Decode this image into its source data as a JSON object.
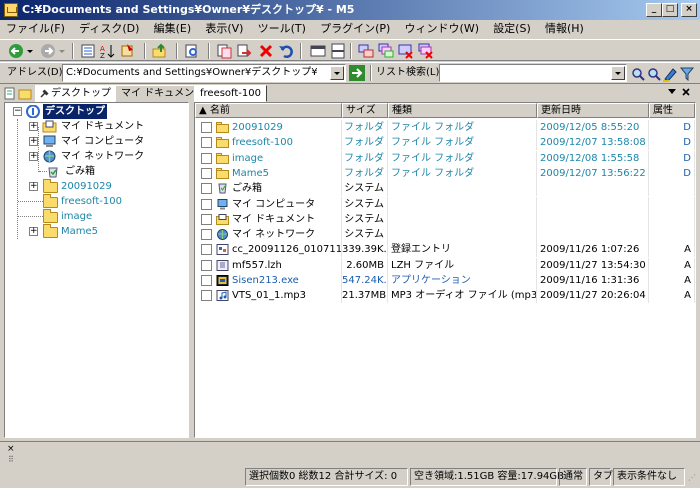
{
  "window": {
    "title": "C:¥Documents and Settings¥Owner¥デスクトップ¥ - M5",
    "min": "_",
    "max": "□",
    "close": "×"
  },
  "menu": [
    "ファイル(F)",
    "ディスク(D)",
    "編集(E)",
    "表示(V)",
    "ツール(T)",
    "プラグイン(P)",
    "ウィンドウ(W)",
    "設定(S)",
    "情報(H)"
  ],
  "address": {
    "label": "アドレス(D)",
    "value": "C:¥Documents and Settings¥Owner¥デスクトップ¥",
    "search_label": "リスト検索(L)",
    "search_value": ""
  },
  "tree_tabs": {
    "desktop": "デスクトップ",
    "mydocs": "マイ ドキュメント"
  },
  "list_tab": "freesoft-100",
  "tree": {
    "root": "デスクトップ",
    "items": [
      "マイ ドキュメント",
      "マイ コンピュータ",
      "マイ ネットワーク",
      "ごみ箱",
      "20091029",
      "freesoft-100",
      "image",
      "Mame5"
    ]
  },
  "columns": {
    "name": "▲ 名前",
    "size": "サイズ",
    "type": "種類",
    "date": "更新日時",
    "attr": "属性"
  },
  "rows": [
    {
      "name": "20091029",
      "size": "フォルダ",
      "type": "ファイル フォルダ",
      "date": "2009/12/05 8:55:20",
      "attr": "D",
      "icon": "folder-icon",
      "color": "teal"
    },
    {
      "name": "freesoft-100",
      "size": "フォルダ",
      "type": "ファイル フォルダ",
      "date": "2009/12/07 13:58:08",
      "attr": "D",
      "icon": "folder-icon",
      "color": "teal"
    },
    {
      "name": "image",
      "size": "フォルダ",
      "type": "ファイル フォルダ",
      "date": "2009/12/08 1:55:58",
      "attr": "D",
      "icon": "folder-icon",
      "color": "teal"
    },
    {
      "name": "Mame5",
      "size": "フォルダ",
      "type": "ファイル フォルダ",
      "date": "2009/12/07 13:56:22",
      "attr": "D",
      "icon": "folder-icon",
      "color": "teal"
    },
    {
      "name": "ごみ箱",
      "size": "システム",
      "type": "",
      "date": "",
      "attr": "",
      "icon": "recycle-bin-icon",
      "color": ""
    },
    {
      "name": "マイ コンピュータ",
      "size": "システム",
      "type": "",
      "date": "",
      "attr": "",
      "icon": "computer-icon",
      "color": ""
    },
    {
      "name": "マイ ドキュメント",
      "size": "システム",
      "type": "",
      "date": "",
      "attr": "",
      "icon": "documents-icon",
      "color": ""
    },
    {
      "name": "マイ ネットワーク",
      "size": "システム",
      "type": "",
      "date": "",
      "attr": "",
      "icon": "network-icon",
      "color": ""
    },
    {
      "name": "cc_20091126_010711.r...",
      "size": "339.39K...",
      "type": "登録エントリ",
      "date": "2009/11/26 1:07:26",
      "attr": "A",
      "icon": "registry-file-icon",
      "color": ""
    },
    {
      "name": "mf557.lzh",
      "size": "2.60MB",
      "type": "LZH ファイル",
      "date": "2009/11/27 13:54:30",
      "attr": "A",
      "icon": "archive-file-icon",
      "color": ""
    },
    {
      "name": "Sisen213.exe",
      "size": "547.24K...",
      "type": "アプリケーション",
      "date": "2009/11/16 1:31:36",
      "attr": "A",
      "icon": "exe-file-icon",
      "color": "blue"
    },
    {
      "name": "VTS_01_1.mp3",
      "size": "21.37MB",
      "type": "MP3 オーディオ ファイル (mp3)",
      "date": "2009/11/27 20:26:04",
      "attr": "A",
      "icon": "audio-file-icon",
      "color": ""
    }
  ],
  "bottom_close": "×",
  "status": {
    "counts": "選択個数0 総数12 合計サイズ: 0",
    "space": "空き領域:1.51GB 容量:17.94GB",
    "mode": "通常",
    "tab": "タブ",
    "filter": "表示条件なし"
  },
  "colors": {
    "titlebar_start": "#0a246a",
    "titlebar_end": "#a6caf0",
    "folder_text": "#1e86a8",
    "exe_text": "#1b5db0"
  }
}
